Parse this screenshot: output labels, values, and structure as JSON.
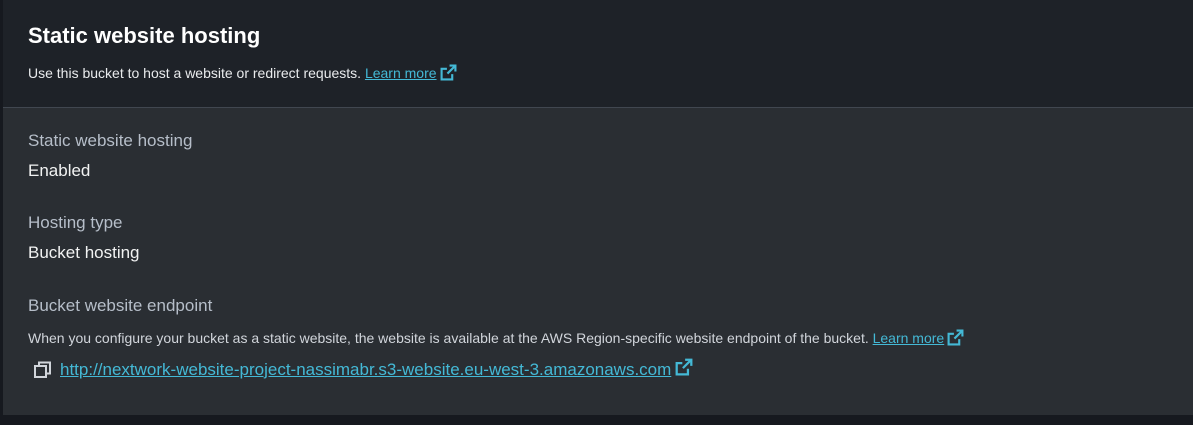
{
  "header": {
    "title": "Static website hosting",
    "description": "Use this bucket to host a website or redirect requests.",
    "learn_more": "Learn more"
  },
  "fields": {
    "hosting": {
      "label": "Static website hosting",
      "value": "Enabled"
    },
    "hosting_type": {
      "label": "Hosting type",
      "value": "Bucket hosting"
    },
    "endpoint": {
      "label": "Bucket website endpoint",
      "description": "When you configure your bucket as a static website, the website is available at the AWS Region-specific website endpoint of the bucket.",
      "learn_more": "Learn more",
      "url": "http://nextwork-website-project-nassimabr.s3-website.eu-west-3.amazonaws.com"
    }
  },
  "icons": {
    "external_link": "external-link-icon",
    "copy": "copy-icon"
  },
  "colors": {
    "link": "#44b9d6",
    "panel_bg": "#2a2e33",
    "header_bg": "#1e2228"
  }
}
